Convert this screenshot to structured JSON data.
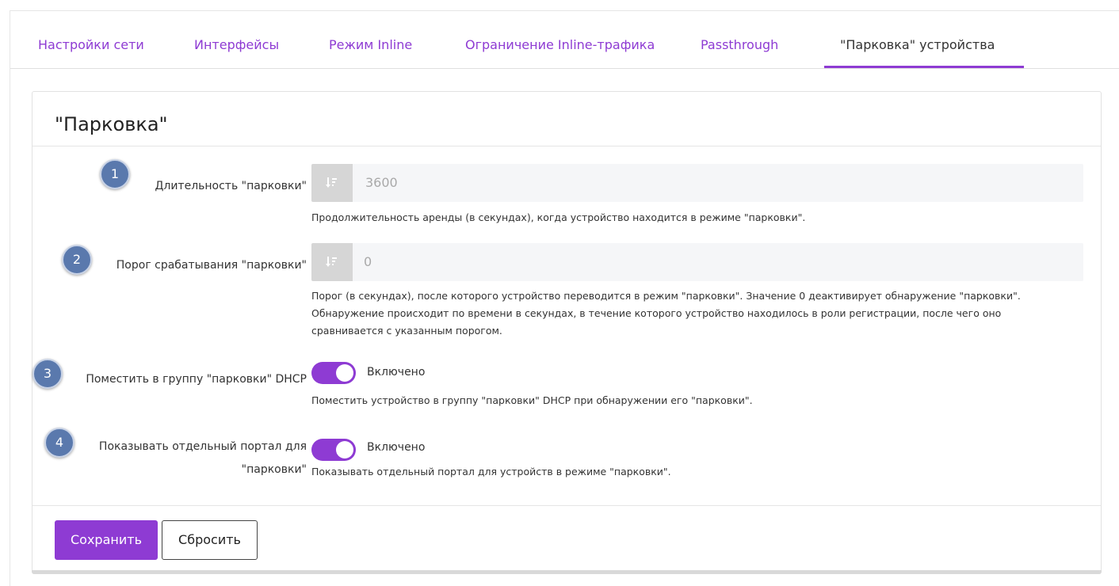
{
  "tabs": [
    {
      "label": "Настройки сети",
      "active": false
    },
    {
      "label": "Интерфейсы",
      "active": false
    },
    {
      "label": "Режим Inline",
      "active": false
    },
    {
      "label": "Ограничение Inline-трафика",
      "active": false
    },
    {
      "label": "Passthrough",
      "active": false
    },
    {
      "label": "\"Парковка\" устройства",
      "active": true
    }
  ],
  "panel": {
    "title": "\"Парковка\""
  },
  "fields": {
    "duration": {
      "badge": "1",
      "label": "Длительность \"парковки\"",
      "value": "3600",
      "help": "Продолжительность аренды (в секундах), когда устройство находится в режиме \"парковки\"."
    },
    "threshold": {
      "badge": "2",
      "label": "Порог срабатывания \"парковки\"",
      "value": "0",
      "help_line1": "Порог (в секундах), после которого устройство переводится в режим \"парковки\". Значение 0 деактивирует обнаружение \"парковки\".",
      "help_line2": "Обнаружение происходит по времени в секундах, в течение которого устройство находилось в роли регистрации, после чего оно",
      "help_line3": "сравнивается с указанным порогом."
    },
    "dhcp_group": {
      "badge": "3",
      "label": "Поместить в группу \"парковки\" DHCP",
      "toggle_label": "Включено",
      "enabled": true,
      "help": "Поместить устройство в группу \"парковки\" DHCP при обнаружении его \"парковки\"."
    },
    "portal": {
      "badge": "4",
      "label_line1": "Показывать отдельный портал для",
      "label_line2": "\"парковки\"",
      "toggle_label": "Включено",
      "enabled": true,
      "help": "Показывать отдельный портал для устройств в режиме \"парковки\"."
    }
  },
  "buttons": {
    "save": "Сохранить",
    "reset": "Сбросить"
  },
  "colors": {
    "accent": "#8e3bd3",
    "badge": "#5a79ad"
  },
  "icons": {
    "input_icon": "sort-numeric-icon"
  }
}
